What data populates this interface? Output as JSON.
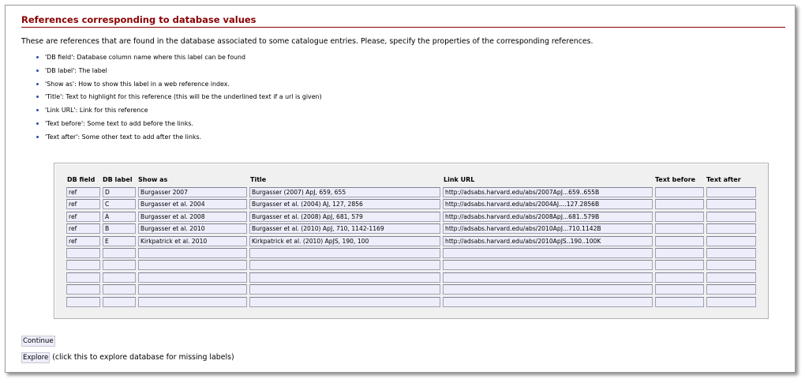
{
  "page": {
    "title": "References corresponding to database values",
    "intro": "These are references that are found in the database associated to some catalogue entries. Please, specify the properties of the corresponding references."
  },
  "bullets": [
    "'DB field': Database column name where this label can be found",
    "'DB label': The label",
    "'Show as': How to show this label in a web reference index.",
    "'Title': Text to highlight for this reference (this will be the underlined text if a url is given)",
    "'Link URL': Link for this reference",
    "'Text before': Some text to add before the links.",
    "'Text after': Some other text to add after the links."
  ],
  "table": {
    "headers": [
      "DB field",
      "DB label",
      "Show as",
      "Title",
      "Link URL",
      "Text before",
      "Text after"
    ],
    "rows": [
      [
        "ref",
        "D",
        "Burgasser 2007",
        "Burgasser (2007) ApJ, 659, 655",
        "http://adsabs.harvard.edu/abs/2007ApJ...659..655B",
        "",
        ""
      ],
      [
        "ref",
        "C",
        "Burgasser et al. 2004",
        "Burgasser et al. (2004) AJ, 127, 2856",
        "http://adsabs.harvard.edu/abs/2004AJ....127.2856B",
        "",
        ""
      ],
      [
        "ref",
        "A",
        "Burgasser et al. 2008",
        "Burgasser et al. (2008) ApJ, 681, 579",
        "http://adsabs.harvard.edu/abs/2008ApJ...681..579B",
        "",
        ""
      ],
      [
        "ref",
        "B",
        "Burgasser et al. 2010",
        "Burgasser et al. (2010) ApJ, 710, 1142-1169",
        "http://adsabs.harvard.edu/abs/2010ApJ...710.1142B",
        "",
        ""
      ],
      [
        "ref",
        "E",
        "Kirkpatrick et al. 2010",
        "Kirkpatrick et al. (2010) ApJS, 190, 100",
        "http://adsabs.harvard.edu/abs/2010ApJS..190..100K",
        "",
        ""
      ],
      [
        "",
        "",
        "",
        "",
        "",
        "",
        ""
      ],
      [
        "",
        "",
        "",
        "",
        "",
        "",
        ""
      ],
      [
        "",
        "",
        "",
        "",
        "",
        "",
        ""
      ],
      [
        "",
        "",
        "",
        "",
        "",
        "",
        ""
      ],
      [
        "",
        "",
        "",
        "",
        "",
        "",
        ""
      ]
    ]
  },
  "actions": {
    "continue_label": "Continue",
    "explore_label": "Explore",
    "explore_note": "(click this to explore database for missing labels)"
  },
  "colors": {
    "title": "#8b0000",
    "bullet": "#2a4fa3",
    "input_bg": "#eeeefb",
    "panel_bg": "#f0f0f0"
  }
}
